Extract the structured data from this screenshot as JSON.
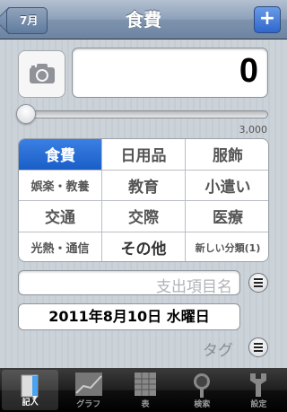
{
  "nav": {
    "back_label": "7月",
    "title": "食費",
    "add_label": "+"
  },
  "entry": {
    "amount": "0",
    "slider_max_label": "3,000",
    "slider_value": 0
  },
  "categories": [
    {
      "label": "食費",
      "selected": true
    },
    {
      "label": "日用品",
      "selected": false
    },
    {
      "label": "服飾",
      "selected": false
    },
    {
      "label": "娯楽・教養",
      "selected": false
    },
    {
      "label": "教育",
      "selected": false
    },
    {
      "label": "小遣い",
      "selected": false
    },
    {
      "label": "交通",
      "selected": false
    },
    {
      "label": "交際",
      "selected": false
    },
    {
      "label": "医療",
      "selected": false
    },
    {
      "label": "光熱・通信",
      "selected": false
    },
    {
      "label": "その他",
      "selected": false
    },
    {
      "label": "新しい分類(1)",
      "selected": false
    }
  ],
  "item": {
    "placeholder": "支出項目名"
  },
  "date": {
    "value": "2011年8月10日 水曜日"
  },
  "tag": {
    "label": "タグ"
  },
  "tabs": [
    {
      "label": "記入",
      "icon": "pencil-icon",
      "active": true
    },
    {
      "label": "グラフ",
      "icon": "graph-icon",
      "active": false
    },
    {
      "label": "表",
      "icon": "table-icon",
      "active": false
    },
    {
      "label": "検索",
      "icon": "magnifier-icon",
      "active": false
    },
    {
      "label": "設定",
      "icon": "wrench-icon",
      "active": false
    }
  ]
}
